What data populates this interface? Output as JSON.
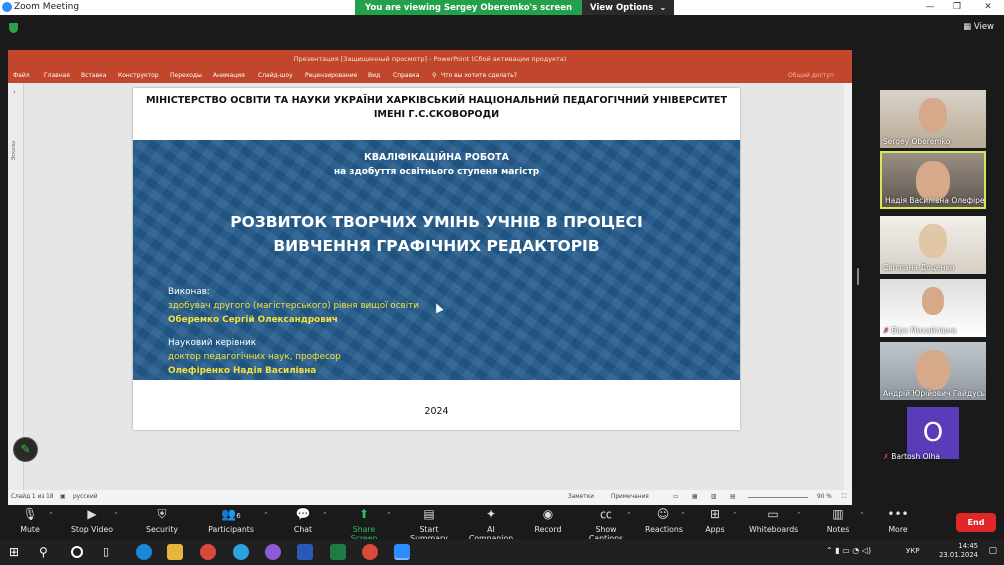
{
  "window": {
    "title": "Zoom Meeting"
  },
  "share_banner": {
    "text": "You are viewing Sergey Oberemko's screen",
    "view_options": "View Options"
  },
  "top_right": {
    "view_label": "View"
  },
  "powerpoint": {
    "title": "Презентация [Защищенный просмотр] - PowerPoint (Сбой активации продукта)",
    "ribbon_tabs": [
      "Файл",
      "Главная",
      "Вставка",
      "Конструктор",
      "Переходы",
      "Анимация",
      "Слайд-шоу",
      "Рецензирование",
      "Вид",
      "Справка"
    ],
    "tell_me": "Что вы хотите сделать?",
    "share": "Общий доступ",
    "thumbs_label": "Эскизы",
    "status": {
      "slide": "Слайд 1 из 18",
      "lang": "русский",
      "notes": "Заметки",
      "comments": "Примечания",
      "zoom": "90 %"
    }
  },
  "slide": {
    "header_line1": "МІНІСТЕРСТВО ОСВІТИ ТА НАУКИ УКРАЇНИ ХАРКІВСЬКИЙ НАЦІОНАЛЬНИЙ ПЕДАГОГІЧНИЙ УНІВЕРСИТЕТ",
    "header_line2": "ІМЕНІ Г.С.СКОВОРОДИ",
    "work_title": "КВАЛІФІКАЦІЙНА РОБОТА",
    "work_subtitle": "на здобуття освітнього ступеня магістр",
    "topic_line1": "РОЗВИТОК ТВОРЧИХ УМІНЬ УЧНІВ В ПРОЦЕСІ",
    "topic_line2": "ВИВЧЕННЯ ГРАФІЧНИХ РЕДАКТОРІВ",
    "performer_label": "Виконав:",
    "performer_role": "здобувач другого (магістерського) рівня вищої освіти",
    "performer_name": "Оберемко Сергій Олександрович",
    "supervisor_label": "Науковий керівник",
    "supervisor_role": "доктор  педагогічних наук, професор",
    "supervisor_name": "Олефіренко Надія Василівна",
    "year": "2024",
    "colors": {
      "band": "#235b8c",
      "yellow": "#f2e23a",
      "highlight_yellow": "#e8e050"
    }
  },
  "participants": [
    {
      "name": "Sergey Oberemko",
      "muted": false
    },
    {
      "name": "Надія Василівна Олефіре...",
      "muted": false,
      "active": true
    },
    {
      "name": "Світлана Доценко",
      "muted": false
    },
    {
      "name": "Віра Михайлівна",
      "muted": true
    },
    {
      "name": "Андрій Юрійович Гайдусь",
      "muted": false
    },
    {
      "name": "Bartosh Olha",
      "muted": true,
      "initial": "O"
    }
  ],
  "toolbar": {
    "mute": "Mute",
    "stop_video": "Stop Video",
    "security": "Security",
    "participants": "Participants",
    "participants_count": "6",
    "chat": "Chat",
    "share_screen": "Share Screen",
    "start_summary": "Start Summary",
    "ai_companion": "AI Companion",
    "record": "Record",
    "captions": "Show Captions",
    "reactions": "Reactions",
    "apps": "Apps",
    "whiteboards": "Whiteboards",
    "notes": "Notes",
    "more": "More",
    "end": "End"
  },
  "taskbar": {
    "lang": "УКР",
    "time": "14:45",
    "date": "23.01.2024"
  }
}
